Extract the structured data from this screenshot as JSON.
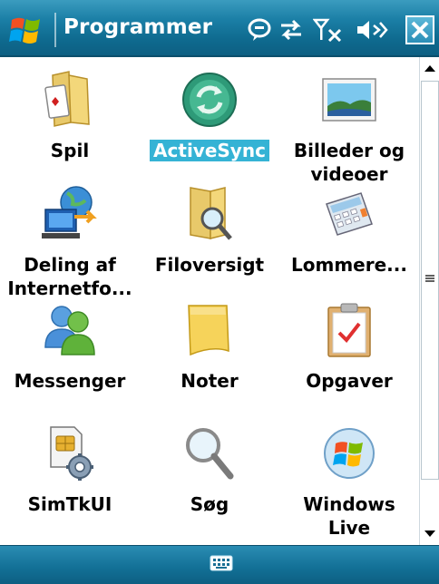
{
  "titlebar": {
    "title": "Programmer"
  },
  "status_icons": [
    "notification-icon",
    "connectivity-icon",
    "signal-off-icon",
    "volume-icon"
  ],
  "programs": [
    {
      "label": "Spil",
      "icon": "games-folder-icon"
    },
    {
      "label": "ActiveSync",
      "icon": "activesync-icon",
      "selected": true
    },
    {
      "label": "Billeder og videoer",
      "icon": "pictures-videos-icon"
    },
    {
      "label": "Deling af Internetfo...",
      "icon": "internet-sharing-icon"
    },
    {
      "label": "Filoversigt",
      "icon": "file-explorer-icon"
    },
    {
      "label": "Lommere...",
      "icon": "calculator-icon"
    },
    {
      "label": "Messenger",
      "icon": "messenger-icon"
    },
    {
      "label": "Noter",
      "icon": "notes-icon"
    },
    {
      "label": "Opgaver",
      "icon": "tasks-icon"
    },
    {
      "label": "SimTkUI",
      "icon": "sim-toolkit-icon"
    },
    {
      "label": "Søg",
      "icon": "search-icon"
    },
    {
      "label": "Windows Live",
      "icon": "windows-live-icon"
    }
  ],
  "bottombar": {
    "input_icon": "keyboard-icon"
  },
  "colors": {
    "titlebar": "#1b7fa6",
    "selection": "#35b3d5",
    "text": "#000000"
  }
}
